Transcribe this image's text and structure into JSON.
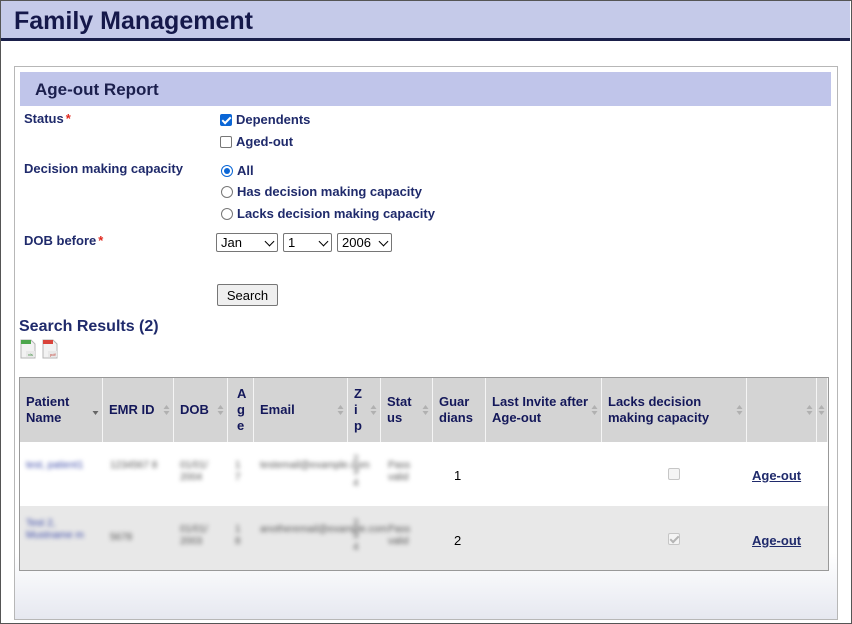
{
  "app": {
    "title": "Family Management"
  },
  "panel": {
    "title": "Age-out Report"
  },
  "form": {
    "status": {
      "label": "Status",
      "required_mark": "*",
      "options": [
        {
          "label": "Dependents",
          "checked": true
        },
        {
          "label": "Aged-out",
          "checked": false
        }
      ]
    },
    "decision": {
      "label": "Decision making capacity",
      "options": [
        {
          "label": "All",
          "checked": true
        },
        {
          "label": "Has decision making capacity",
          "checked": false
        },
        {
          "label": "Lacks decision making capacity",
          "checked": false
        }
      ]
    },
    "dob": {
      "label": "DOB before",
      "required_mark": "*",
      "month": "Jan",
      "day": "1",
      "year": "2006"
    },
    "search_button": "Search"
  },
  "results": {
    "title": "Search Results (2)",
    "export_icons": [
      "excel-export-icon",
      "pdf-export-icon"
    ],
    "columns": [
      "Patient Name",
      "EMR ID",
      "DOB",
      "Age",
      "Email",
      "Zip",
      "Status",
      "Guardians",
      "Last Invite after Age-out",
      "Lacks decision making capacity",
      "",
      ""
    ],
    "rows": [
      {
        "patient_name": "test, patient1",
        "emr_id": "1234567 8",
        "dob": "01/01/ 2004",
        "age": "1 7",
        "email": "testemail@example.com",
        "zip": "2 3 4",
        "status": "Pass valid",
        "guardians": "1",
        "lacks_capacity": false,
        "action": "Age-out"
      },
      {
        "patient_name": "Test 2, Mustname m",
        "emr_id": "5678",
        "dob": "01/01/ 2003",
        "age": "1 8",
        "email": "anotheremail@example.com",
        "zip": "2 3 4",
        "status": "Pass valid",
        "guardians": "2",
        "lacks_capacity": true,
        "action": "Age-out"
      }
    ]
  }
}
